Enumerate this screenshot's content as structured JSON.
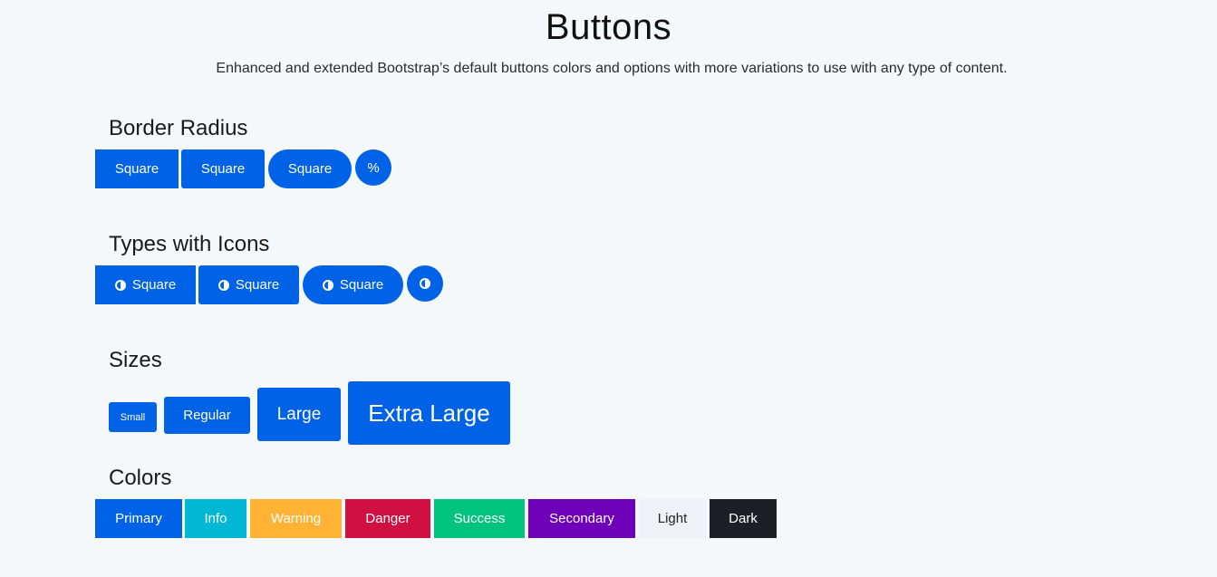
{
  "header": {
    "title": "Buttons",
    "subtitle": "Enhanced and extended Bootstrap’s default buttons colors and options with more variations to use with any type of content."
  },
  "border_radius": {
    "title": "Border Radius",
    "buttons": [
      "Square",
      "Square",
      "Square",
      "%"
    ]
  },
  "icons": {
    "title": "Types with Icons",
    "icon_name": "half-circle-icon",
    "buttons": [
      "Square",
      "Square",
      "Square"
    ]
  },
  "sizes": {
    "title": "Sizes",
    "buttons": [
      "Small",
      "Regular",
      "Large",
      "Extra Large"
    ]
  },
  "colors": {
    "title": "Colors",
    "buttons": [
      {
        "label": "Primary",
        "color": "#0062e6"
      },
      {
        "label": "Info",
        "color": "#00b8d4"
      },
      {
        "label": "Warning",
        "color": "#ffb233"
      },
      {
        "label": "Danger",
        "color": "#d11042"
      },
      {
        "label": "Success",
        "color": "#00c37e"
      },
      {
        "label": "Secondary",
        "color": "#6d00b8"
      },
      {
        "label": "Light",
        "color": "#eef2f7"
      },
      {
        "label": "Dark",
        "color": "#1c1f24"
      }
    ]
  }
}
